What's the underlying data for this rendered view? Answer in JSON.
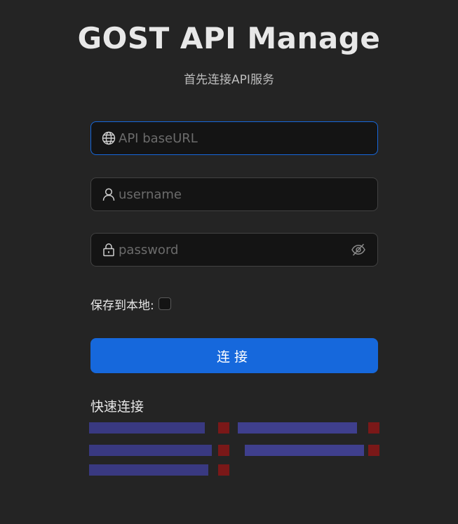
{
  "app": {
    "title": "GOST API Manage",
    "subtitle": "首先连接API服务"
  },
  "form": {
    "baseurl": {
      "placeholder": "API baseURL",
      "value": "",
      "icon": "globe-icon"
    },
    "username": {
      "placeholder": "username",
      "value": "",
      "icon": "user-icon"
    },
    "password": {
      "placeholder": "password",
      "value": "",
      "icon": "lock-icon",
      "toggle_icon": "eye-invisible-icon"
    },
    "save_label": "保存到本地:",
    "save_checked": false,
    "connect_label": "连接"
  },
  "quick": {
    "title": "快速连接"
  },
  "colors": {
    "background": "#242424",
    "input_bg": "#141414",
    "accent": "#1668dc",
    "border": "#424242"
  }
}
